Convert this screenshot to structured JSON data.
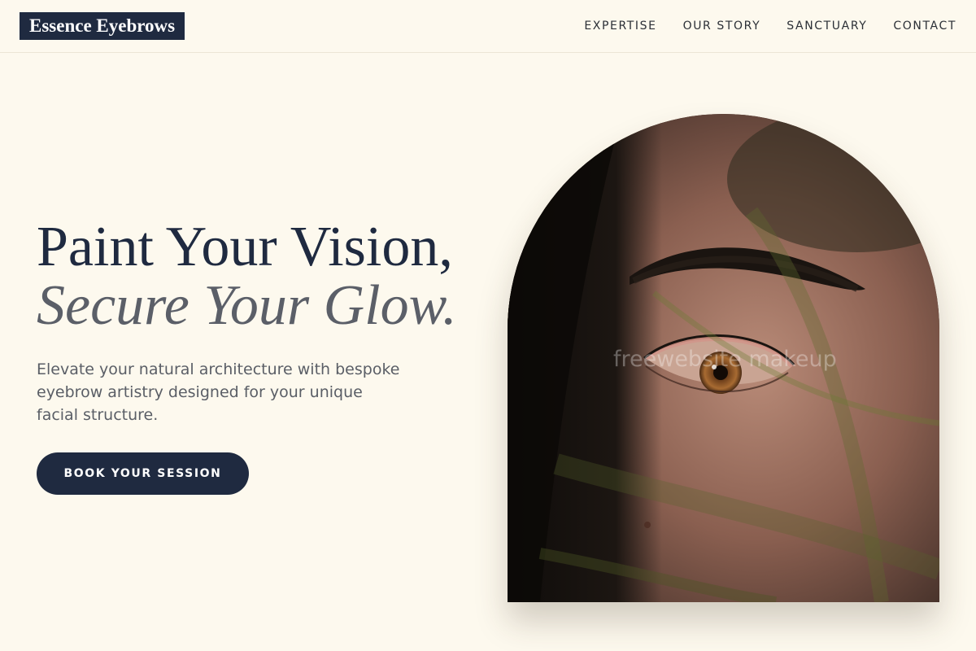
{
  "brand": {
    "name": "Essence Eyebrows"
  },
  "nav": {
    "items": [
      {
        "label": "EXPERTISE"
      },
      {
        "label": "OUR STORY"
      },
      {
        "label": "SANCTUARY"
      },
      {
        "label": "CONTACT"
      }
    ]
  },
  "hero": {
    "headline_line1": "Paint Your Vision,",
    "headline_line2": "Secure Your Glow.",
    "subtext": "Elevate your natural architecture with bespoke eyebrow artistry designed for your unique facial structure.",
    "cta_label": "BOOK YOUR SESSION",
    "watermark": "freewebsite makeup"
  },
  "colors": {
    "background": "#fdf9ee",
    "navy": "#1f2a40",
    "muted_text": "#5a5e66"
  }
}
